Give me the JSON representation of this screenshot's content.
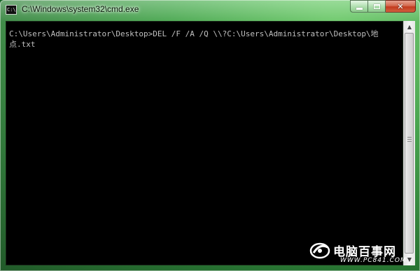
{
  "window": {
    "title": "C:\\Windows\\system32\\cmd.exe",
    "icon_label": "C:\\",
    "controls": {
      "minimize": "minimize",
      "maximize": "maximize",
      "close": "close"
    }
  },
  "console": {
    "text": "C:\\Users\\Administrator\\Desktop>DEL /F /A /Q \\\\?C:\\Users\\Administrator\\Desktop\\地点.txt",
    "text_color": "#c0c0c0",
    "background": "#000000"
  },
  "scrollbar": {
    "up_icon": "up-arrow-icon",
    "down_icon": "down-arrow-icon"
  },
  "watermark": {
    "brand": "电脑百事网",
    "url": "WWW.PC841.COM"
  }
}
